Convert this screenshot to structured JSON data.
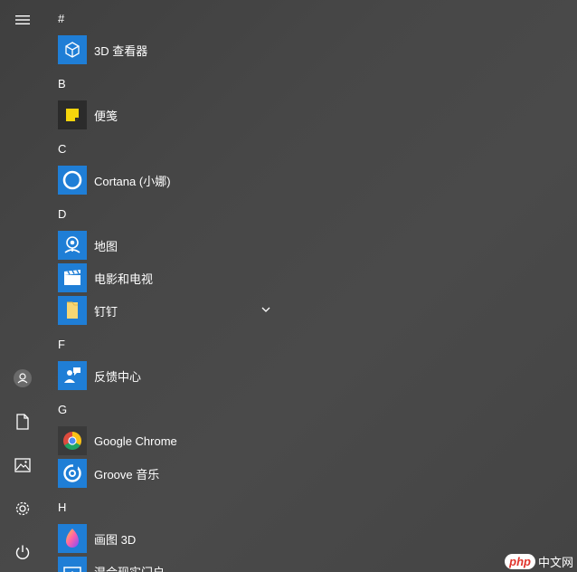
{
  "rail": {
    "items": [
      {
        "name": "hamburger-menu-icon"
      },
      {
        "name": "user-account-icon"
      },
      {
        "name": "documents-icon"
      },
      {
        "name": "pictures-icon"
      },
      {
        "name": "settings-gear-icon"
      },
      {
        "name": "power-icon"
      }
    ]
  },
  "app_list": {
    "groups": [
      {
        "letter": "#",
        "apps": [
          {
            "label": "3D 查看器",
            "icon": "3d-viewer-icon",
            "tile_color": "#1f7ed6"
          }
        ]
      },
      {
        "letter": "B",
        "apps": [
          {
            "label": "便笺",
            "icon": "sticky-notes-icon",
            "tile_color": "#2b2b2b"
          }
        ]
      },
      {
        "letter": "C",
        "apps": [
          {
            "label": "Cortana (小娜)",
            "icon": "cortana-icon",
            "tile_color": "#1f7ed6"
          }
        ]
      },
      {
        "letter": "D",
        "apps": [
          {
            "label": "地图",
            "icon": "maps-icon",
            "tile_color": "#1f7ed6"
          },
          {
            "label": "电影和电视",
            "icon": "movies-tv-icon",
            "tile_color": "#1f7ed6"
          },
          {
            "label": "钉钉",
            "icon": "folder-icon",
            "tile_color": "#1f7ed6",
            "expandable": true
          }
        ]
      },
      {
        "letter": "F",
        "apps": [
          {
            "label": "反馈中心",
            "icon": "feedback-hub-icon",
            "tile_color": "#1f7ed6"
          }
        ]
      },
      {
        "letter": "G",
        "apps": [
          {
            "label": "Google Chrome",
            "icon": "chrome-icon",
            "tile_color": "#3a3a3a"
          },
          {
            "label": "Groove 音乐",
            "icon": "groove-music-icon",
            "tile_color": "#1f7ed6"
          }
        ]
      },
      {
        "letter": "H",
        "apps": [
          {
            "label": "画图 3D",
            "icon": "paint-3d-icon",
            "tile_color": "#1f7ed6"
          },
          {
            "label": "混合现实门户",
            "icon": "mixed-reality-icon",
            "tile_color": "#1f7ed6"
          }
        ]
      }
    ]
  },
  "watermark": {
    "php": "php",
    "text": "中文网"
  },
  "colors": {
    "accent": "#1f7ed6",
    "background": "#474747"
  }
}
